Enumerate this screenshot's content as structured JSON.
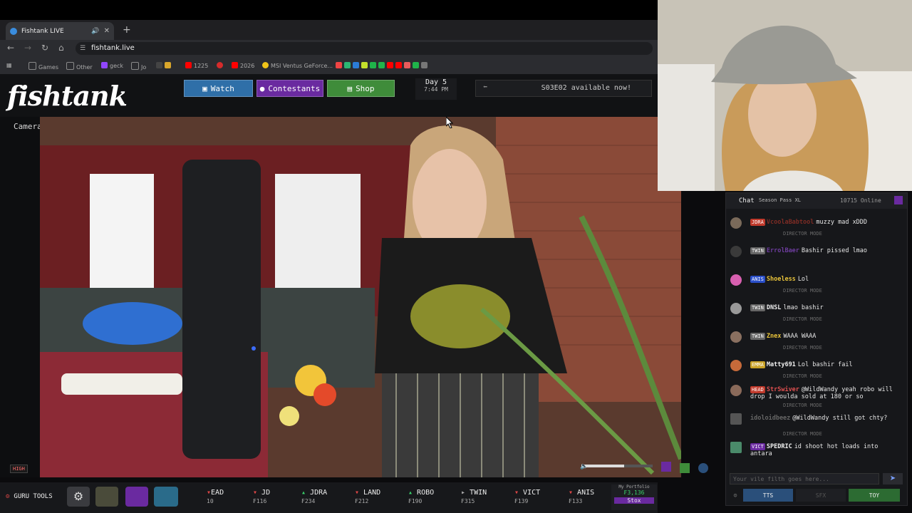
{
  "browser": {
    "tab_title": "Fishtank LIVE",
    "url": "fishtank.live",
    "bookmarks": [
      {
        "label": "Games",
        "icon": "folder-icon",
        "color": "#8a8a8a"
      },
      {
        "label": "Other",
        "icon": "folder-icon",
        "color": "#8a8a8a"
      },
      {
        "label": "geck",
        "icon": "twitch-icon",
        "color": "#9146ff"
      },
      {
        "label": "Jo",
        "icon": "folder-icon",
        "color": "#8a8a8a"
      },
      {
        "label": "1225",
        "icon": "youtube-icon",
        "color": "#ff0000"
      },
      {
        "label": "2026",
        "icon": "youtube-icon",
        "color": "#ff0000"
      },
      {
        "label": "MSI Ventus GeForce...",
        "icon": "coin-icon",
        "color": "#f0c419"
      }
    ]
  },
  "site": {
    "logo": "fishtank",
    "nav": [
      {
        "label": "Watch",
        "icon": "tv-icon",
        "bg": "#2f6fa8"
      },
      {
        "label": "Contestants",
        "icon": "people-icon",
        "bg": "#6a2aa0"
      },
      {
        "label": "Shop",
        "icon": "cart-icon",
        "bg": "#3f8c3a"
      }
    ],
    "day": "Day 5",
    "time": "7:44 PM",
    "announcement": "S03E02 available now!"
  },
  "stream": {
    "camera_name": "Cameraman",
    "quality": "HIGH"
  },
  "chat": {
    "tabs": [
      "Chat",
      "Season Pass XL"
    ],
    "online": "10715 Online",
    "director_mode": "DIRECTOR MODE",
    "messages": [
      {
        "badge": "JDRA",
        "badge_color": "#c0392b",
        "user": "VcoolaBabtool",
        "user_color": "#c0392b",
        "text": "muzzy mad xDDD",
        "dim": true
      },
      {
        "badge": "TWIN",
        "badge_color": "#666",
        "user": "ErrolBaer",
        "user_color": "#a855f7",
        "text": "Bashir pissed lmao",
        "dim": true
      },
      {
        "badge": "ANIS",
        "badge_color": "#2a4fc9",
        "user": "Shoeless",
        "user_color": "#e8c33a",
        "text": "Lol",
        "dim": false
      },
      {
        "badge": "TWIN",
        "badge_color": "#666",
        "user": "DNSL",
        "user_color": "#f0f0f0",
        "text": "lmao bashir",
        "dim": false
      },
      {
        "badge": "TWIN",
        "badge_color": "#666",
        "user": "Znex",
        "user_color": "#e8c33a",
        "text": "WAAA WAAA",
        "dim": false
      },
      {
        "badge": "EMMA",
        "badge_color": "#c9a227",
        "user": "Matty691",
        "user_color": "#f0f0f0",
        "text": "Lol bashir fail",
        "dim": false
      },
      {
        "badge": "HEAD",
        "badge_color": "#c0392b",
        "user": "StrSwiver",
        "user_color": "#e05050",
        "text": "@WildWandy yeah robo will drop I woulda sold at 180 or so",
        "dim": false
      },
      {
        "badge": "",
        "badge_color": "#444",
        "user": "idoloidbeez",
        "user_color": "#666",
        "text": "@WildWandy still got chty?",
        "dim": true
      },
      {
        "badge": "VICT",
        "badge_color": "#6a2aa0",
        "user": "SPEDRIC",
        "user_color": "#f0f0f0",
        "text": "id shoot hot loads into antara",
        "dim": false
      }
    ],
    "input_placeholder": "Your vile filth goes here...",
    "buttons": [
      "TTS",
      "SFX",
      "TOY"
    ]
  },
  "bottom": {
    "guru": "GURU TOOLS",
    "tickers": [
      {
        "name": "EAD",
        "dir": "fl",
        "val": "10"
      },
      {
        "name": "JD",
        "dir": "dn",
        "val": "₣116"
      },
      {
        "name": "JDRA",
        "dir": "up",
        "val": "₣234"
      },
      {
        "name": "LAND",
        "dir": "dn",
        "val": "₣212"
      },
      {
        "name": "ROBO",
        "dir": "up",
        "val": "₣190"
      },
      {
        "name": "TWIN",
        "dir": "fl",
        "val": "₣315"
      },
      {
        "name": "VICT",
        "dir": "dn",
        "val": "₣139"
      },
      {
        "name": "ANIS",
        "dir": "dn",
        "val": "₣133"
      }
    ],
    "portfolio_label": "My Portfolio",
    "portfolio_value": "₣3,136",
    "stox": "Stox"
  }
}
